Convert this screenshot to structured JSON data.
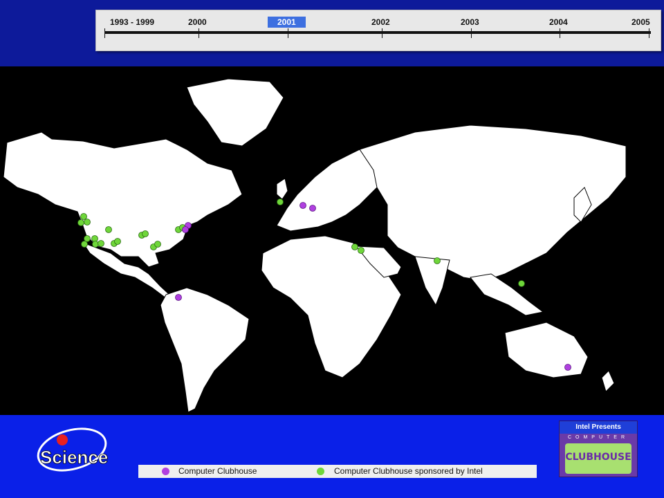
{
  "timeline": {
    "years": [
      "1993 - 1999",
      "2000",
      "2001",
      "2002",
      "2003",
      "2004",
      "2005"
    ],
    "selected": "2001"
  },
  "legend": {
    "item1": "Computer Clubhouse",
    "item2": "Computer Clubhouse sponsored by Intel",
    "color1": "#b040e0",
    "color2": "#6fd63a"
  },
  "logos": {
    "science": "Science",
    "clubhouse_header": "Intel Presents",
    "clubhouse_sub": "COMPUTER",
    "clubhouse_word": "CLUBHOUSE"
  }
}
